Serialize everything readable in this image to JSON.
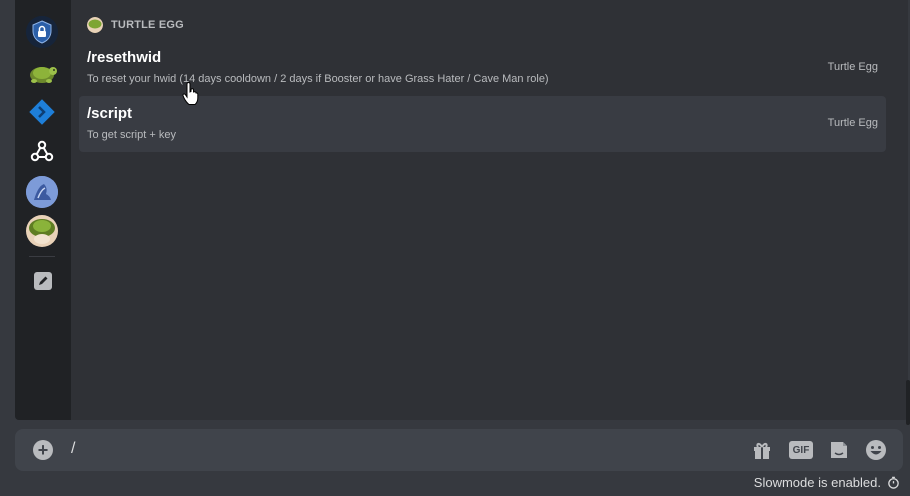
{
  "autocomplete": {
    "section_title": "TURTLE EGG",
    "servers": [
      {
        "name": "shield-lock-server",
        "icon": "shield-lock-icon"
      },
      {
        "name": "turtle-egg-server",
        "icon": "turtle-icon"
      },
      {
        "name": "blue-diamond-server",
        "icon": "diamond-icon"
      },
      {
        "name": "webhook-server",
        "icon": "webhook-icon"
      },
      {
        "name": "blue-avatar-server",
        "icon": "avatar-icon"
      },
      {
        "name": "turtle-avatar-server",
        "icon": "turtle-icon"
      }
    ],
    "commands": [
      {
        "name": "/resethwid",
        "description": "To reset your hwid (14 days cooldown / 2 days if Booster or have Grass Hater / Cave Man role)",
        "source": "Turtle Egg",
        "active": false
      },
      {
        "name": "/script",
        "description": "To get script + key",
        "source": "Turtle Egg",
        "active": true
      }
    ]
  },
  "composer": {
    "text": "/",
    "tools": [
      "gift-icon",
      "gif-icon",
      "sticker-icon",
      "emoji-icon"
    ],
    "gif_label": "GIF"
  },
  "footer": {
    "slowmode_text": "Slowmode is enabled."
  },
  "colors": {
    "background": "#36393f",
    "popup": "#2f3136",
    "sidebar": "#202225",
    "active_row": "#393c43",
    "composer": "#40444b",
    "text_muted": "#b9bbbe",
    "text_primary": "#ffffff"
  }
}
